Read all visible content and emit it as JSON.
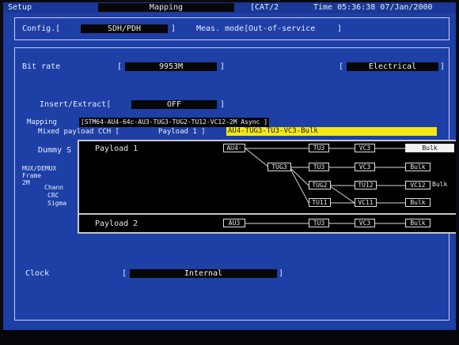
{
  "topbar": {
    "setup": "Setup",
    "mode": "Mapping",
    "port": "[CAT/2",
    "time": "Time 05:36:38 07/Jan/2000"
  },
  "config": {
    "label": "Config.[",
    "value": "SDH/PDH",
    "close": "]",
    "meas_label": "Meas. mode[",
    "meas_value": "Out-of-service",
    "meas_close": "]"
  },
  "bitrate": {
    "label": "Bit rate",
    "open": "[",
    "value": "9953M",
    "close": "]",
    "interface_open": "[",
    "interface_value": "Electrical",
    "interface_close": "]"
  },
  "insert": {
    "label": "Insert/Extract[",
    "value": "OFF",
    "close": "]"
  },
  "mapping": {
    "label": "Mapping",
    "value": "[STM64-AU4-64c-AU3-TUG3-TUG2-TU12-VC12-2M Async ]",
    "mixed_label": "Mixed payload CCH [",
    "payload_label": "Payload 1 ]",
    "payload_value": "AU4-TUG3-TU3-VC3-Bulk"
  },
  "dummy": {
    "label": "Dummy S"
  },
  "muxdemux": {
    "line1": "MUX/DEMUX",
    "line2": "Frame",
    "line3_a": "2M",
    "line3_b": "Chann",
    "line4": "CRC",
    "line5": "Sigma"
  },
  "popup": {
    "payload1": "Payload 1",
    "payload2": "Payload 2",
    "row1": [
      "AU4-",
      "TU3",
      "VC3",
      "Bulk"
    ],
    "row2": [
      "TUG3",
      "TU3",
      "VC3",
      "Bulk"
    ],
    "row3": [
      "TUG2",
      "TU12",
      "VC12",
      "Bulk"
    ],
    "row4": [
      "TU11",
      "VC11",
      "Bulk"
    ],
    "row5": [
      "AU3",
      "TU3",
      "VC3",
      "Bulk"
    ]
  },
  "clock": {
    "label": "Clock",
    "open": "[",
    "value": "Internal",
    "close": "]"
  },
  "colors": {
    "screen": "#1d3fa6",
    "highlight": "#f3e814",
    "popup_bg": "#000000"
  }
}
